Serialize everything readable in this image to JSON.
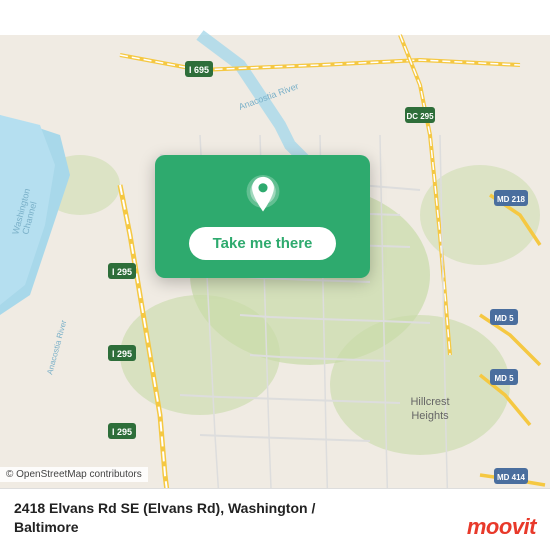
{
  "map": {
    "alt": "Map of Washington DC area showing 2418 Elvans Rd SE"
  },
  "overlay": {
    "button_label": "Take me there"
  },
  "info": {
    "address": "2418 Elvans Rd SE (Elvans Rd), Washington /",
    "city": "Baltimore"
  },
  "credit": {
    "text": "© OpenStreetMap contributors"
  },
  "branding": {
    "logo": "moovit"
  },
  "colors": {
    "green": "#2eaa6e",
    "red": "#e8392a",
    "road_yellow": "#f5c842",
    "highway_green": "#4a9e5c",
    "water_blue": "#a8d8ea",
    "land_light": "#f0ebe3",
    "land_green": "#c8dba8"
  }
}
